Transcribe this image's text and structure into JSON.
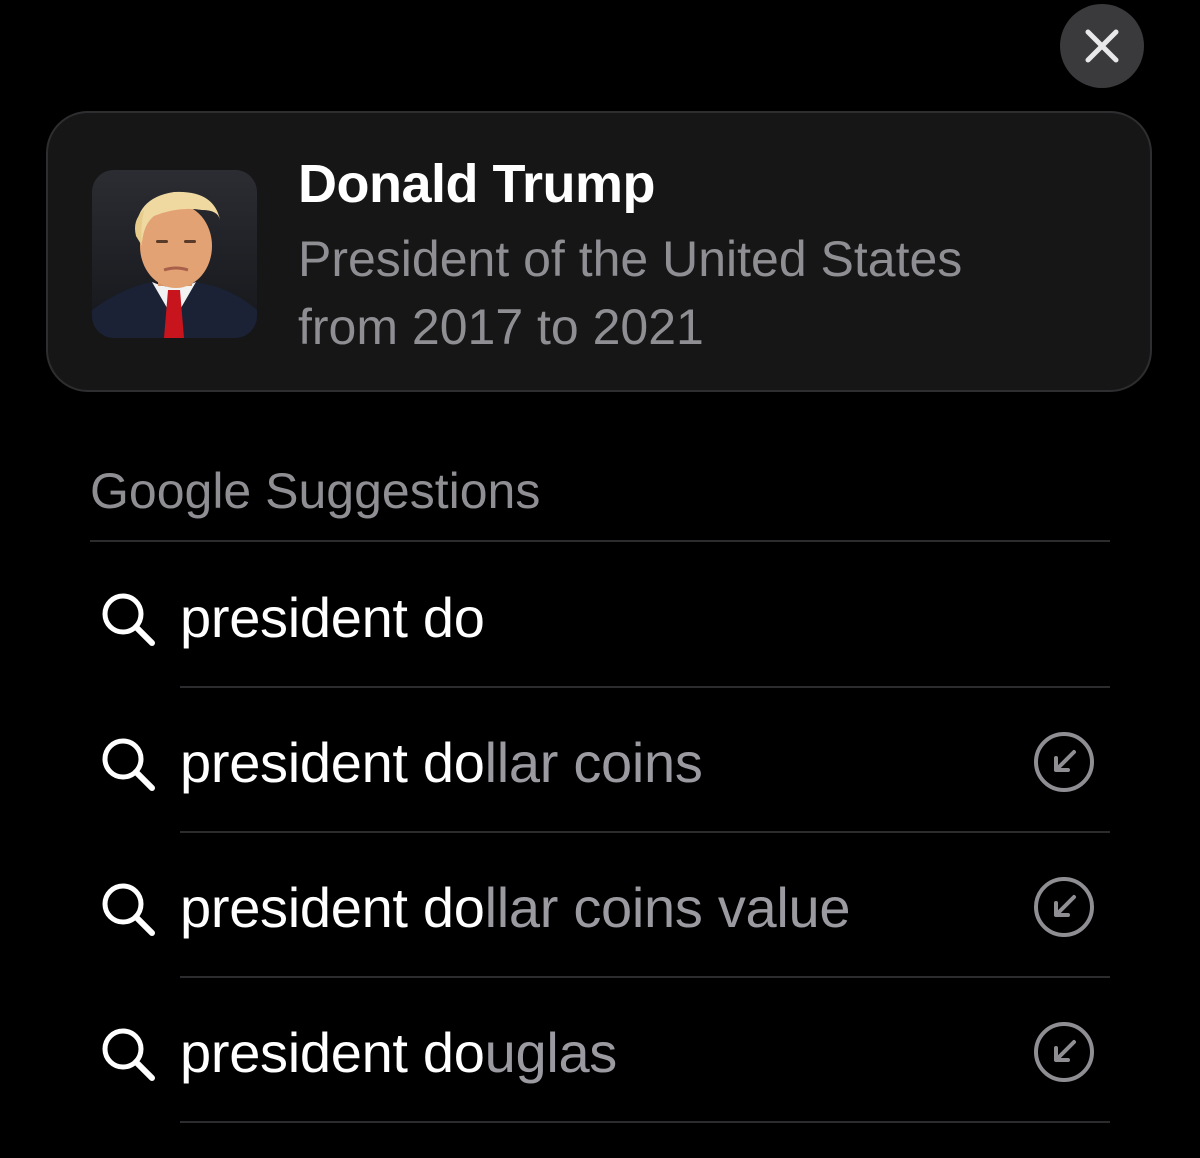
{
  "close_button": {
    "icon": "close-icon"
  },
  "result_card": {
    "title": "Donald Trump",
    "description_line1": "President of the United States",
    "description_line2": "from 2017 to 2021",
    "thumbnail": "portrait-photo"
  },
  "google_suggestions": {
    "header": "Google Suggestions",
    "items": [
      {
        "typed": "president do",
        "completion": "",
        "has_fill_button": false
      },
      {
        "typed": "president do",
        "completion": "llar coins",
        "has_fill_button": true
      },
      {
        "typed": "president do",
        "completion": "llar coins value",
        "has_fill_button": true
      },
      {
        "typed": "president do",
        "completion": "uglas",
        "has_fill_button": true
      }
    ]
  },
  "colors": {
    "background": "#000000",
    "card": "#161616",
    "secondary_text": "#8e8e93",
    "completion_text": "#9a9aa0",
    "divider": "#2c2c2e",
    "close_button_bg": "#3a3a3c"
  }
}
